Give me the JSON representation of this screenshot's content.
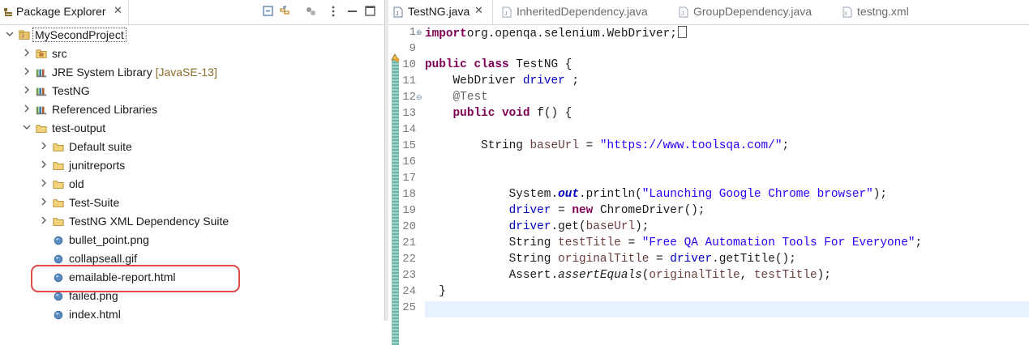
{
  "package_explorer": {
    "tab_label": "Package Explorer",
    "tab_close": "✕",
    "toolbar_icons": [
      "collapse-all-icon",
      "link-with-editor-icon",
      "focus-icon",
      "view-menu-icon",
      "minimize-icon",
      "maximize-icon"
    ],
    "tree": [
      {
        "label": "MySecondProject",
        "twisty": "v",
        "icon": "project-icon",
        "selected": true
      },
      {
        "label": "src",
        "twisty": ">",
        "icon": "source-folder-icon"
      },
      {
        "label": "JRE System Library",
        "decoration": "[JavaSE-13]",
        "twisty": ">",
        "icon": "library-icon"
      },
      {
        "label": "TestNG",
        "twisty": ">",
        "icon": "library-icon"
      },
      {
        "label": "Referenced Libraries",
        "twisty": ">",
        "icon": "library-icon"
      },
      {
        "label": "test-output",
        "twisty": "v",
        "icon": "folder-icon"
      },
      {
        "label": "Default suite",
        "twisty": ">",
        "icon": "folder-icon"
      },
      {
        "label": "junitreports",
        "twisty": ">",
        "icon": "folder-icon"
      },
      {
        "label": "old",
        "twisty": ">",
        "icon": "folder-icon"
      },
      {
        "label": "Test-Suite",
        "twisty": ">",
        "icon": "folder-icon"
      },
      {
        "label": "TestNG XML Dependency Suite",
        "twisty": ">",
        "icon": "folder-icon"
      },
      {
        "label": "bullet_point.png",
        "twisty": "",
        "icon": "file-icon"
      },
      {
        "label": "collapseall.gif",
        "twisty": "",
        "icon": "file-icon"
      },
      {
        "label": "emailable-report.html",
        "twisty": "",
        "icon": "file-icon",
        "highlighted": true
      },
      {
        "label": "failed.png",
        "twisty": "",
        "icon": "file-icon"
      },
      {
        "label": "index.html",
        "twisty": "",
        "icon": "file-icon"
      }
    ]
  },
  "editor": {
    "tabs": [
      {
        "label": "TestNG.java",
        "active": true,
        "close": "✕",
        "icon": "java-file-icon"
      },
      {
        "label": "InheritedDependency.java",
        "active": false,
        "icon": "java-file-icon"
      },
      {
        "label": "GroupDependency.java",
        "active": false,
        "icon": "java-file-icon"
      },
      {
        "label": "testng.xml",
        "active": false,
        "icon": "xml-file-icon"
      }
    ],
    "line_numbers": [
      "1",
      "9",
      "10",
      "11",
      "12",
      "13",
      "14",
      "15",
      "16",
      "17",
      "18",
      "19",
      "20",
      "21",
      "22",
      "23",
      "24",
      "25"
    ],
    "code_lines": [
      [
        [
          "kw",
          "import"
        ],
        [
          "",
          "org.openqa.selenium.WebDriver;"
        ]
      ],
      [],
      [
        [
          "kw",
          "public"
        ],
        [
          "",
          " "
        ],
        [
          "kw",
          "class"
        ],
        [
          "",
          " TestNG {"
        ]
      ],
      [
        [
          "",
          "    WebDriver "
        ],
        [
          "fld",
          "driver"
        ],
        [
          "",
          " ;"
        ]
      ],
      [
        [
          "ann",
          "    @Test"
        ]
      ],
      [
        [
          "",
          "    "
        ],
        [
          "kw",
          "public"
        ],
        [
          "",
          " "
        ],
        [
          "kw",
          "void"
        ],
        [
          "",
          " f() {"
        ]
      ],
      [],
      [
        [
          "",
          "        String "
        ],
        [
          "ident",
          "baseUrl"
        ],
        [
          "",
          " = "
        ],
        [
          "str",
          "\"https://www.toolsqa.com/\""
        ],
        [
          "",
          ";"
        ]
      ],
      [],
      [],
      [
        [
          "",
          "            System."
        ],
        [
          "static",
          "out"
        ],
        [
          "",
          ".println("
        ],
        [
          "str",
          "\"Launching Google Chrome browser\""
        ],
        [
          "",
          ");"
        ]
      ],
      [
        [
          "",
          "            "
        ],
        [
          "fld",
          "driver"
        ],
        [
          "",
          " = "
        ],
        [
          "kw",
          "new"
        ],
        [
          "",
          " ChromeDriver();"
        ]
      ],
      [
        [
          "",
          "            "
        ],
        [
          "fld",
          "driver"
        ],
        [
          "",
          ".get("
        ],
        [
          "ident",
          "baseUrl"
        ],
        [
          "",
          ");"
        ]
      ],
      [
        [
          "",
          "            String "
        ],
        [
          "ident",
          "testTitle"
        ],
        [
          "",
          " = "
        ],
        [
          "str",
          "\"Free QA Automation Tools For Everyone\""
        ],
        [
          "",
          ";"
        ]
      ],
      [
        [
          "",
          "            String "
        ],
        [
          "ident",
          "originalTitle"
        ],
        [
          "",
          " = "
        ],
        [
          "fld",
          "driver"
        ],
        [
          "",
          ".getTitle();"
        ]
      ],
      [
        [
          "",
          "            Assert."
        ],
        [
          "ital",
          "assertEquals"
        ],
        [
          "",
          "("
        ],
        [
          "ident",
          "originalTitle"
        ],
        [
          "",
          ", "
        ],
        [
          "ident",
          "testTitle"
        ],
        [
          "",
          ");"
        ]
      ],
      [
        [
          "",
          "  }"
        ]
      ],
      []
    ]
  }
}
